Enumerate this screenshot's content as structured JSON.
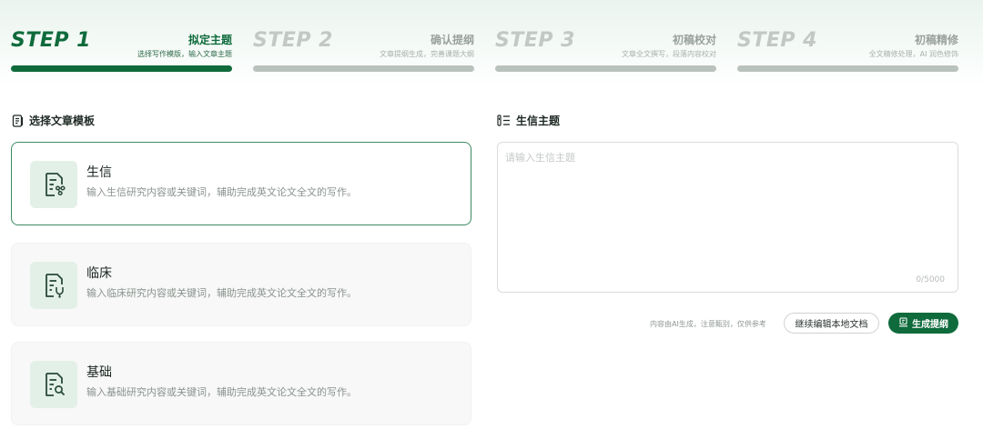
{
  "steps": [
    {
      "num": "STEP 1",
      "title": "拟定主题",
      "sub": "选择写作模版，输入文章主题",
      "state": "active"
    },
    {
      "num": "STEP 2",
      "title": "确认提纲",
      "sub": "文章提纲生成，完善课题大纲",
      "state": "inactive"
    },
    {
      "num": "STEP 3",
      "title": "初稿校对",
      "sub": "文章全文撰写，段落内容校对",
      "state": "inactive"
    },
    {
      "num": "STEP 4",
      "title": "初稿精修",
      "sub": "全文精修处理，AI 润色修饰",
      "state": "inactive"
    }
  ],
  "left": {
    "heading": "选择文章模板",
    "heading_icon": "document-list-icon",
    "templates": [
      {
        "title": "生信",
        "desc": "输入生信研究内容或关键词，辅助完成英文论文全文的写作。",
        "icon": "bioinformatics-doc-icon",
        "selected": true
      },
      {
        "title": "临床",
        "desc": "输入临床研究内容或关键词，辅助完成英文论文全文的写作。",
        "icon": "clinical-doc-icon",
        "selected": false
      },
      {
        "title": "基础",
        "desc": "输入基础研究内容或关键词，辅助完成英文论文全文的写作。",
        "icon": "basic-research-doc-icon",
        "selected": false
      }
    ]
  },
  "right": {
    "heading": "生信主题",
    "heading_icon": "topic-list-icon",
    "input": {
      "placeholder": "请输入生信主题",
      "value": "",
      "counter": "0/5000"
    },
    "note": "内容由AI生成，注意甄别，仅供参考",
    "continue_label": "继续编辑本地文档",
    "generate_label": "生成提纲",
    "generate_icon": "outline-generate-icon"
  },
  "colors": {
    "accent": "#0f6b3c",
    "inactive_bar": "#b9c2bd",
    "card_icon_bg": "#e3f0e8"
  }
}
